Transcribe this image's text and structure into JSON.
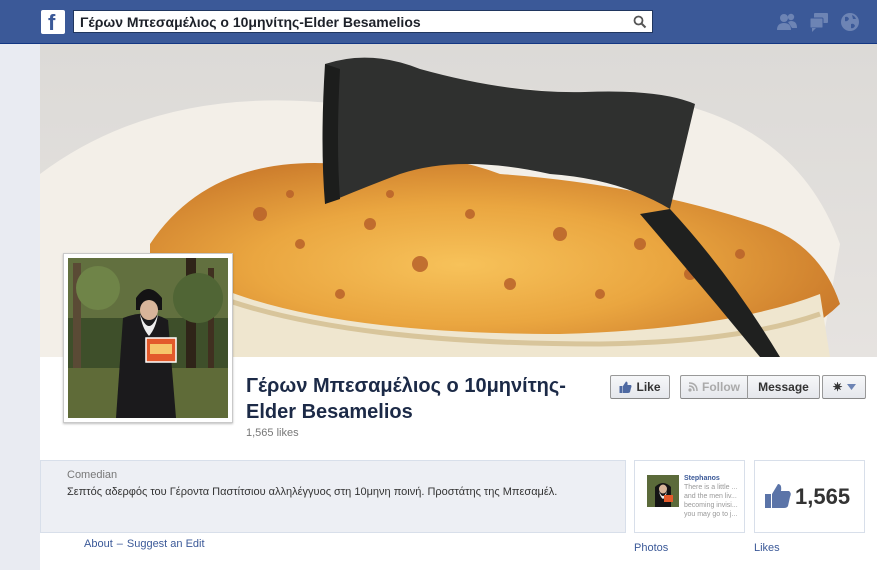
{
  "search": {
    "value": "Γέρων Μπεσαμέλιος ο 10μηνίτης-Elder Besamelios"
  },
  "page": {
    "title": "Γέρων Μπεσαμέλιος ο 10μηνίτης-Elder Besamelios",
    "likes_sub": "1,565 likes",
    "category": "Comedian",
    "about_text": "Σεπτός αδερφός του Γέροντα Παστίτσιου αλληλέγγυος στη 10μηνη ποινή. Προστάτης της Μπεσαμέλ."
  },
  "actions": {
    "like_label": "Like",
    "follow_label": "Follow",
    "message_label": "Message"
  },
  "links": {
    "about": "About",
    "separator": "–",
    "suggest_edit": "Suggest an Edit"
  },
  "apps": {
    "photos_label": "Photos",
    "likes_label": "Likes",
    "likes_count": "1,565",
    "preview_author": "Stephanos",
    "preview_text": "There is a little ... and the men liv... becoming invisi... you may go to j..."
  },
  "icons": [
    "facebook-logo-icon",
    "search-icon",
    "friend-requests-icon",
    "messages-icon",
    "notifications-globe-icon",
    "thumbs-up-icon",
    "rss-follow-icon",
    "gear-icon",
    "chevron-down-icon"
  ],
  "colors": {
    "brand": "#3b5998",
    "topbar_border": "#133783",
    "info_bg": "#edeff4"
  }
}
